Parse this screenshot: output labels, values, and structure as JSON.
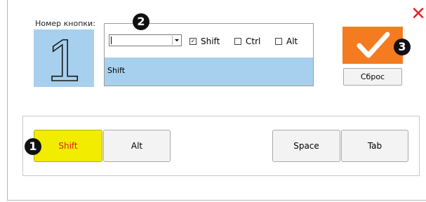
{
  "dialog": {
    "close_glyph": "✕",
    "close_color": "#e0262b"
  },
  "button_number": {
    "label": "Номер кнопки:",
    "value": "1",
    "background": "#a6d0ed"
  },
  "modifiers": {
    "key_select_value": "",
    "checkboxes": [
      {
        "label": "Shift",
        "checked": true
      },
      {
        "label": "Ctrl",
        "checked": false
      },
      {
        "label": "Alt",
        "checked": false
      }
    ],
    "combination_text": "Shift"
  },
  "actions": {
    "apply_icon": "checkmark-icon",
    "apply_color": "#f47b20",
    "reset_label": "Сброс"
  },
  "layout_buttons": [
    {
      "label": "Shift",
      "active": true
    },
    {
      "label": "Alt",
      "active": false
    },
    {
      "label": "Space",
      "active": false
    },
    {
      "label": "Tab",
      "active": false
    }
  ],
  "callouts": [
    "1",
    "2",
    "3"
  ]
}
